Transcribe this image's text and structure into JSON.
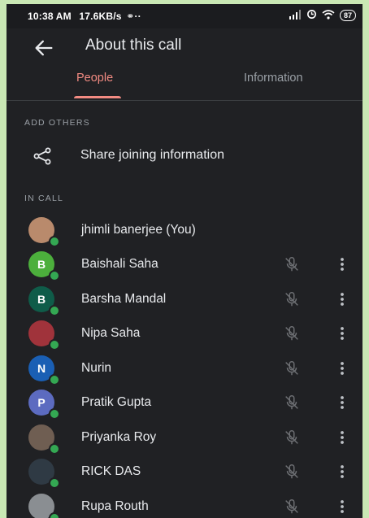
{
  "status": {
    "time": "10:38 AM",
    "speed": "17.6KB/s",
    "battery": "87"
  },
  "header": {
    "title": "About this call"
  },
  "tabs": [
    {
      "label": "People",
      "active": true
    },
    {
      "label": "Information",
      "active": false
    }
  ],
  "sections": {
    "add_others": "ADD OTHERS",
    "in_call": "IN CALL"
  },
  "share": {
    "label": "Share joining information"
  },
  "participants": [
    {
      "name": "jhimli banerjee (You)",
      "initial": "",
      "avatar_color": "#b98a6c"
    },
    {
      "name": "Baishali Saha",
      "initial": "B",
      "avatar_color": "#4caf3c"
    },
    {
      "name": "Barsha Mandal",
      "initial": "B",
      "avatar_color": "#0f5c49"
    },
    {
      "name": "Nipa Saha",
      "initial": "",
      "avatar_color": "#a0333b"
    },
    {
      "name": "Nurin",
      "initial": "N",
      "avatar_color": "#1a5fb4"
    },
    {
      "name": "Pratik Gupta",
      "initial": "P",
      "avatar_color": "#5c6bc0"
    },
    {
      "name": "Priyanka Roy",
      "initial": "",
      "avatar_color": "#6f5e52"
    },
    {
      "name": "RICK DAS",
      "initial": "",
      "avatar_color": "#2f3a44"
    },
    {
      "name": "Rupa Routh",
      "initial": "",
      "avatar_color": "#8a8e92"
    }
  ],
  "colors": {
    "accent": "#f28b82",
    "background": "#202124",
    "online": "#34a853"
  }
}
